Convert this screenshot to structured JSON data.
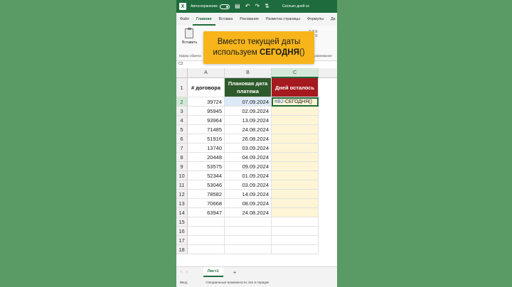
{
  "titlebar": {
    "logo": "X",
    "autosave_label": "Автосохранение",
    "file_name": "Сколько дней ос"
  },
  "tabs": [
    {
      "label": "Файл",
      "active": false
    },
    {
      "label": "Главная",
      "active": true
    },
    {
      "label": "Вставка",
      "active": false
    },
    {
      "label": "Рисование",
      "active": false
    },
    {
      "label": "Разметка страницы",
      "active": false
    },
    {
      "label": "Формулы",
      "active": false
    },
    {
      "label": "Да",
      "active": false
    }
  ],
  "ribbon": {
    "paste_label": "Вставить",
    "clipboard_group": "Буфер обмена",
    "alignment_group": "Выравнивание"
  },
  "callout": {
    "line1": "Вместо текущей даты",
    "line2_prefix": "используем ",
    "line2_bold": "СЕГОДНЯ",
    "line2_suffix": "()"
  },
  "formula_bar": {
    "name_box": "C2",
    "partial_formula": "=B2-СЕГОДНЯ()"
  },
  "columns": [
    "A",
    "B",
    "C"
  ],
  "selected_column": "C",
  "header_row": {
    "a": "# договора",
    "b": "Плановая дата платежа",
    "c": "Дней осталось"
  },
  "active_cell_formula": {
    "ref": "B2",
    "rest": "-СЕГОДНЯ()",
    "prefix": "="
  },
  "rows": [
    {
      "num": "2",
      "a": "39724",
      "b": "07.09.2024"
    },
    {
      "num": "3",
      "a": "95945",
      "b": "02.09.2024"
    },
    {
      "num": "4",
      "a": "93964",
      "b": "13.09.2024"
    },
    {
      "num": "5",
      "a": "71485",
      "b": "24.08.2024"
    },
    {
      "num": "6",
      "a": "51916",
      "b": "26.08.2024"
    },
    {
      "num": "7",
      "a": "13740",
      "b": "03.09.2024"
    },
    {
      "num": "8",
      "a": "20448",
      "b": "04.09.2024"
    },
    {
      "num": "9",
      "a": "53575",
      "b": "09.09.2024"
    },
    {
      "num": "10",
      "a": "52344",
      "b": "01.09.2024"
    },
    {
      "num": "11",
      "a": "53046",
      "b": "03.09.2024"
    },
    {
      "num": "12",
      "a": "78582",
      "b": "14.09.2024"
    },
    {
      "num": "13",
      "a": "70668",
      "b": "08.09.2024"
    },
    {
      "num": "14",
      "a": "63947",
      "b": "24.08.2024"
    }
  ],
  "empty_rows": [
    "15",
    "16",
    "17",
    "18"
  ],
  "sheetbar": {
    "sheet_name": "Лист1",
    "add_symbol": "+"
  },
  "statusbar": {
    "ready": "Ввод",
    "accessibility": "Специальные возможности: все в порядке"
  },
  "colors": {
    "excel_green": "#1e6b3d",
    "header_b_bg": "#2d5a2b",
    "header_c_bg": "#a41a1e",
    "tint_c": "#fdf5d5",
    "callout_bg": "#f7b51b",
    "background": "#5a9a64"
  }
}
